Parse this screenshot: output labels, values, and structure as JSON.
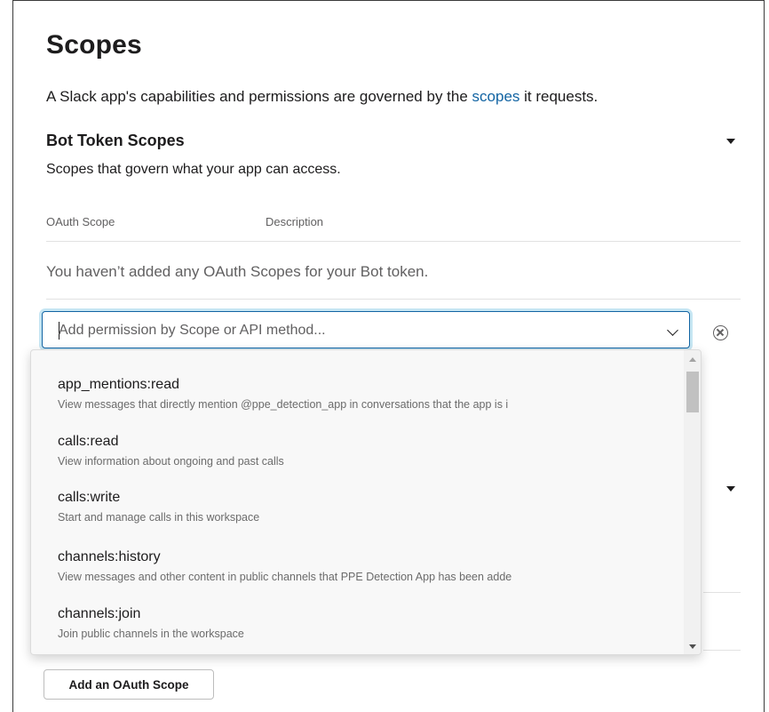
{
  "page": {
    "title": "Scopes",
    "intro_before": "A Slack app's capabilities and permissions are governed by the ",
    "intro_link": "scopes",
    "intro_after": " it requests."
  },
  "bot_section": {
    "title": "Bot Token Scopes",
    "subtitle": "Scopes that govern what your app can access.",
    "col_scope": "OAuth Scope",
    "col_description": "Description",
    "empty_message": "You haven’t added any OAuth Scopes for your Bot token.",
    "add_button": "Add an OAuth Scope"
  },
  "scope_select": {
    "placeholder": "Add permission by Scope or API method...",
    "options": [
      {
        "name": "app_mentions:read",
        "description": "View messages that directly mention @ppe_detection_app in conversations that the app is i"
      },
      {
        "name": "calls:read",
        "description": "View information about ongoing and past calls"
      },
      {
        "name": "calls:write",
        "description": "Start and manage calls in this workspace"
      },
      {
        "name": "channels:history",
        "description": "View messages and other content in public channels that PPE Detection App has been adde"
      },
      {
        "name": "channels:join",
        "description": "Join public channels in the workspace"
      }
    ]
  },
  "colors": {
    "link": "#1264a3",
    "focus_border": "#1264a3",
    "text": "#1d1c1d",
    "muted": "#616061"
  },
  "icons": {
    "section_toggle": "caret-down-icon",
    "select_chevron": "chevron-down-icon",
    "clear": "close-circle-icon"
  }
}
